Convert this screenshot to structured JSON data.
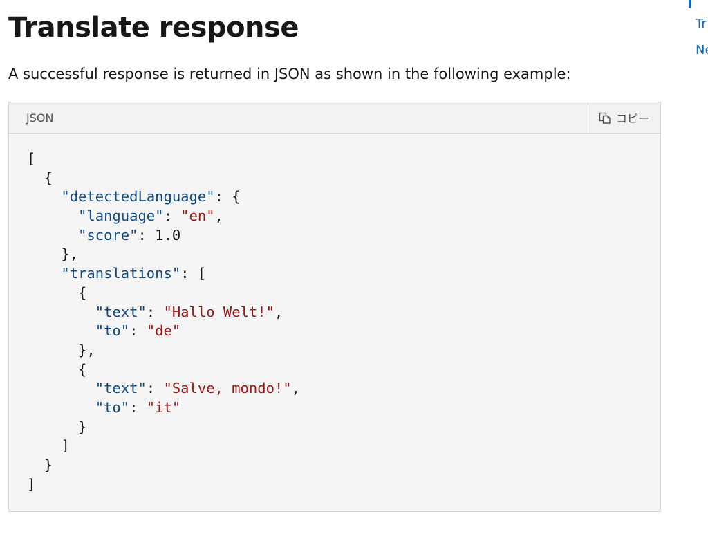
{
  "page": {
    "title": "Translate response",
    "intro": "A successful response is returned in JSON as shown in the following example:"
  },
  "code_block": {
    "language": "JSON",
    "copy_label": "コピー",
    "copy_icon": "copy-icon",
    "lines": [
      [
        [
          "p",
          "["
        ]
      ],
      [
        [
          "p",
          "  {"
        ]
      ],
      [
        [
          "p",
          "    "
        ],
        [
          "k",
          "\"detectedLanguage\""
        ],
        [
          "p",
          ": {"
        ]
      ],
      [
        [
          "p",
          "      "
        ],
        [
          "k",
          "\"language\""
        ],
        [
          "p",
          ": "
        ],
        [
          "s",
          "\"en\""
        ],
        [
          "p",
          ","
        ]
      ],
      [
        [
          "p",
          "      "
        ],
        [
          "k",
          "\"score\""
        ],
        [
          "p",
          ": 1.0"
        ]
      ],
      [
        [
          "p",
          "    },"
        ]
      ],
      [
        [
          "p",
          "    "
        ],
        [
          "k",
          "\"translations\""
        ],
        [
          "p",
          ": ["
        ]
      ],
      [
        [
          "p",
          "      {"
        ]
      ],
      [
        [
          "p",
          "        "
        ],
        [
          "k",
          "\"text\""
        ],
        [
          "p",
          ": "
        ],
        [
          "s",
          "\"Hallo Welt!\""
        ],
        [
          "p",
          ","
        ]
      ],
      [
        [
          "p",
          "        "
        ],
        [
          "k",
          "\"to\""
        ],
        [
          "p",
          ": "
        ],
        [
          "s",
          "\"de\""
        ]
      ],
      [
        [
          "p",
          "      },"
        ]
      ],
      [
        [
          "p",
          "      {"
        ]
      ],
      [
        [
          "p",
          "        "
        ],
        [
          "k",
          "\"text\""
        ],
        [
          "p",
          ": "
        ],
        [
          "s",
          "\"Salve, mondo!\""
        ],
        [
          "p",
          ","
        ]
      ],
      [
        [
          "p",
          "        "
        ],
        [
          "k",
          "\"to\""
        ],
        [
          "p",
          ": "
        ],
        [
          "s",
          "\"it\""
        ]
      ],
      [
        [
          "p",
          "      }"
        ]
      ],
      [
        [
          "p",
          "    ]"
        ]
      ],
      [
        [
          "p",
          "  }"
        ]
      ],
      [
        [
          "p",
          "]"
        ]
      ]
    ]
  },
  "toc": {
    "items": [
      "Tr",
      "Ne"
    ]
  },
  "colors": {
    "key": "#0f4a85",
    "string": "#a31515",
    "link": "#0f6cbd"
  }
}
